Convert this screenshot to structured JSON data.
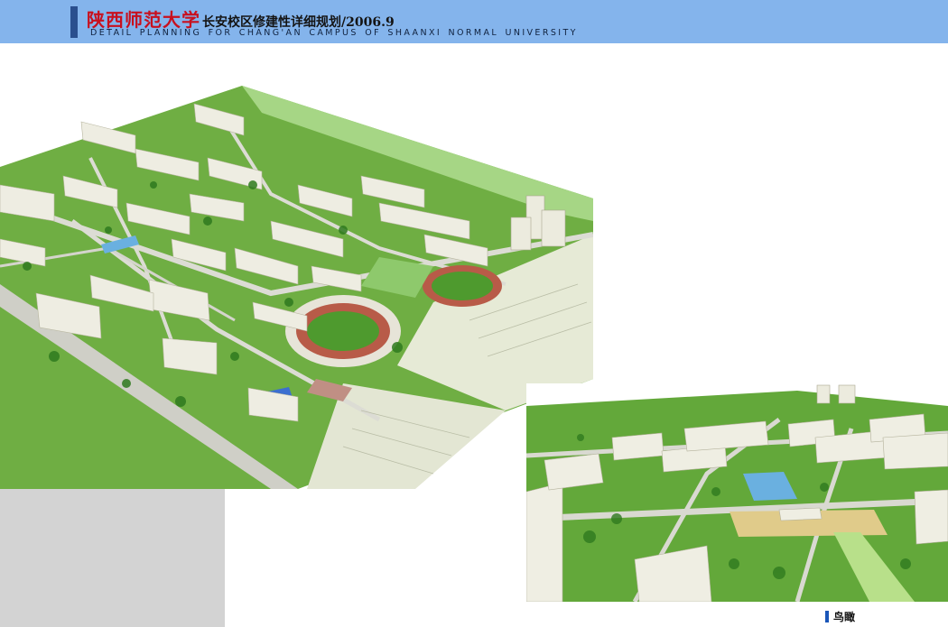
{
  "header": {
    "title_cn_main": "陕西师范大学",
    "title_cn_sub": "长安校区修建性详细规划/2006.9",
    "subtitle_en": "DETAIL PLANNING FOR CHANG'AN CAMPUS OF SHAANXI NORMAL UNIVERSITY",
    "bar_color": "#2a4f8e",
    "background_color": "#84b4ec"
  },
  "caption": {
    "text": "鸟瞰",
    "marker_color": "#1a56b8"
  },
  "colors": {
    "lawn": "#4f9a2c",
    "lawn_light": "#8cc76a",
    "road": "#d8d8d0",
    "building": "#ecebe0",
    "stadium_track": "#b85b48",
    "water": "#6ab0e0"
  }
}
